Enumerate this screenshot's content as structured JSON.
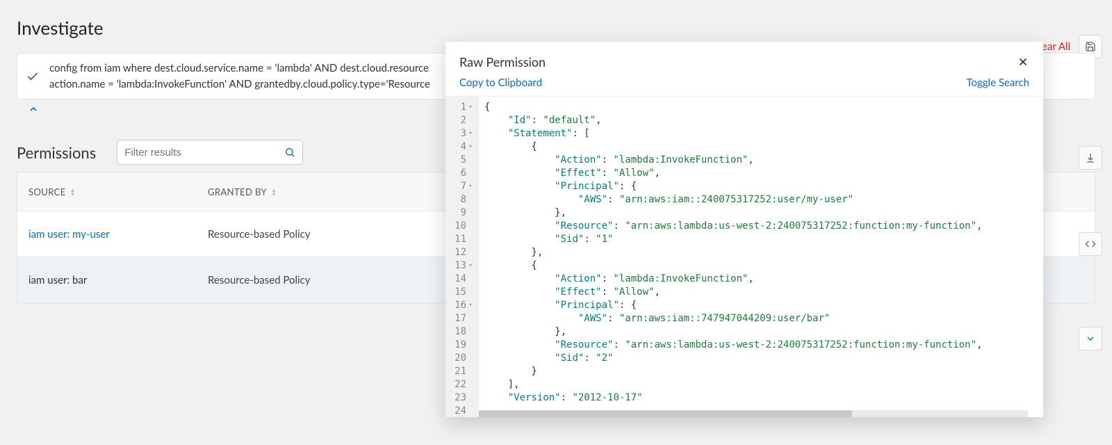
{
  "page": {
    "title": "Investigate"
  },
  "actions": {
    "clear_all": "Clear All"
  },
  "query": {
    "line1": "config from iam where dest.cloud.service.name = 'lambda' AND dest.cloud.resource",
    "line2": "action.name = 'lambda:InvokeFunction' AND grantedby.cloud.policy.type='Resource"
  },
  "permissions": {
    "title": "Permissions",
    "filter_placeholder": "Filter results",
    "columns": {
      "source": "SOURCE",
      "granted_by": "GRANTED BY"
    },
    "rows": [
      {
        "source": "iam user: my-user",
        "granted_by": "Resource-based Policy",
        "link": true,
        "selected": false
      },
      {
        "source": "iam user: bar",
        "granted_by": "Resource-based Policy",
        "link": false,
        "selected": true
      }
    ]
  },
  "modal": {
    "title": "Raw Permission",
    "copy": "Copy to Clipboard",
    "toggle": "Toggle Search",
    "gutter": [
      {
        "n": "1",
        "f": true
      },
      {
        "n": "2",
        "f": false
      },
      {
        "n": "3",
        "f": true
      },
      {
        "n": "4",
        "f": true
      },
      {
        "n": "5",
        "f": false
      },
      {
        "n": "6",
        "f": false
      },
      {
        "n": "7",
        "f": true
      },
      {
        "n": "8",
        "f": false
      },
      {
        "n": "9",
        "f": false
      },
      {
        "n": "10",
        "f": false
      },
      {
        "n": "11",
        "f": false
      },
      {
        "n": "12",
        "f": false
      },
      {
        "n": "13",
        "f": true
      },
      {
        "n": "14",
        "f": false
      },
      {
        "n": "15",
        "f": false
      },
      {
        "n": "16",
        "f": true
      },
      {
        "n": "17",
        "f": false
      },
      {
        "n": "18",
        "f": false
      },
      {
        "n": "19",
        "f": false
      },
      {
        "n": "20",
        "f": false
      },
      {
        "n": "21",
        "f": false
      },
      {
        "n": "22",
        "f": false
      },
      {
        "n": "23",
        "f": false
      },
      {
        "n": "24",
        "f": false
      }
    ],
    "code_lines": [
      [
        {
          "t": "p",
          "v": "{"
        }
      ],
      [
        {
          "t": "p",
          "v": "    "
        },
        {
          "t": "k",
          "v": "\"Id\""
        },
        {
          "t": "p",
          "v": ": "
        },
        {
          "t": "s",
          "v": "\"default\""
        },
        {
          "t": "p",
          "v": ","
        }
      ],
      [
        {
          "t": "p",
          "v": "    "
        },
        {
          "t": "k",
          "v": "\"Statement\""
        },
        {
          "t": "p",
          "v": ": ["
        }
      ],
      [
        {
          "t": "p",
          "v": "        {"
        }
      ],
      [
        {
          "t": "p",
          "v": "            "
        },
        {
          "t": "k",
          "v": "\"Action\""
        },
        {
          "t": "p",
          "v": ": "
        },
        {
          "t": "s",
          "v": "\"lambda:InvokeFunction\""
        },
        {
          "t": "p",
          "v": ","
        }
      ],
      [
        {
          "t": "p",
          "v": "            "
        },
        {
          "t": "k",
          "v": "\"Effect\""
        },
        {
          "t": "p",
          "v": ": "
        },
        {
          "t": "s",
          "v": "\"Allow\""
        },
        {
          "t": "p",
          "v": ","
        }
      ],
      [
        {
          "t": "p",
          "v": "            "
        },
        {
          "t": "k",
          "v": "\"Principal\""
        },
        {
          "t": "p",
          "v": ": {"
        }
      ],
      [
        {
          "t": "p",
          "v": "                "
        },
        {
          "t": "k",
          "v": "\"AWS\""
        },
        {
          "t": "p",
          "v": ": "
        },
        {
          "t": "s",
          "v": "\"arn:aws:iam::240075317252:user/my-user\""
        }
      ],
      [
        {
          "t": "p",
          "v": "            },"
        }
      ],
      [
        {
          "t": "p",
          "v": "            "
        },
        {
          "t": "k",
          "v": "\"Resource\""
        },
        {
          "t": "p",
          "v": ": "
        },
        {
          "t": "s",
          "v": "\"arn:aws:lambda:us-west-2:240075317252:function:my-function\""
        },
        {
          "t": "p",
          "v": ","
        }
      ],
      [
        {
          "t": "p",
          "v": "            "
        },
        {
          "t": "k",
          "v": "\"Sid\""
        },
        {
          "t": "p",
          "v": ": "
        },
        {
          "t": "s",
          "v": "\"1\""
        }
      ],
      [
        {
          "t": "p",
          "v": "        },"
        }
      ],
      [
        {
          "t": "p",
          "v": "        {"
        }
      ],
      [
        {
          "t": "p",
          "v": "            "
        },
        {
          "t": "k",
          "v": "\"Action\""
        },
        {
          "t": "p",
          "v": ": "
        },
        {
          "t": "s",
          "v": "\"lambda:InvokeFunction\""
        },
        {
          "t": "p",
          "v": ","
        }
      ],
      [
        {
          "t": "p",
          "v": "            "
        },
        {
          "t": "k",
          "v": "\"Effect\""
        },
        {
          "t": "p",
          "v": ": "
        },
        {
          "t": "s",
          "v": "\"Allow\""
        },
        {
          "t": "p",
          "v": ","
        }
      ],
      [
        {
          "t": "p",
          "v": "            "
        },
        {
          "t": "k",
          "v": "\"Principal\""
        },
        {
          "t": "p",
          "v": ": {"
        }
      ],
      [
        {
          "t": "p",
          "v": "                "
        },
        {
          "t": "k",
          "v": "\"AWS\""
        },
        {
          "t": "p",
          "v": ": "
        },
        {
          "t": "s",
          "v": "\"arn:aws:iam::747947044209:user/bar\""
        }
      ],
      [
        {
          "t": "p",
          "v": "            },"
        }
      ],
      [
        {
          "t": "p",
          "v": "            "
        },
        {
          "t": "k",
          "v": "\"Resource\""
        },
        {
          "t": "p",
          "v": ": "
        },
        {
          "t": "s",
          "v": "\"arn:aws:lambda:us-west-2:240075317252:function:my-function\""
        },
        {
          "t": "p",
          "v": ","
        }
      ],
      [
        {
          "t": "p",
          "v": "            "
        },
        {
          "t": "k",
          "v": "\"Sid\""
        },
        {
          "t": "p",
          "v": ": "
        },
        {
          "t": "s",
          "v": "\"2\""
        }
      ],
      [
        {
          "t": "p",
          "v": "        }"
        }
      ],
      [
        {
          "t": "p",
          "v": "    ],"
        }
      ],
      [
        {
          "t": "p",
          "v": "    "
        },
        {
          "t": "k",
          "v": "\"Version\""
        },
        {
          "t": "p",
          "v": ": "
        },
        {
          "t": "s",
          "v": "\"2012-10-17\""
        }
      ],
      [
        {
          "t": "p",
          "v": ""
        }
      ]
    ]
  }
}
